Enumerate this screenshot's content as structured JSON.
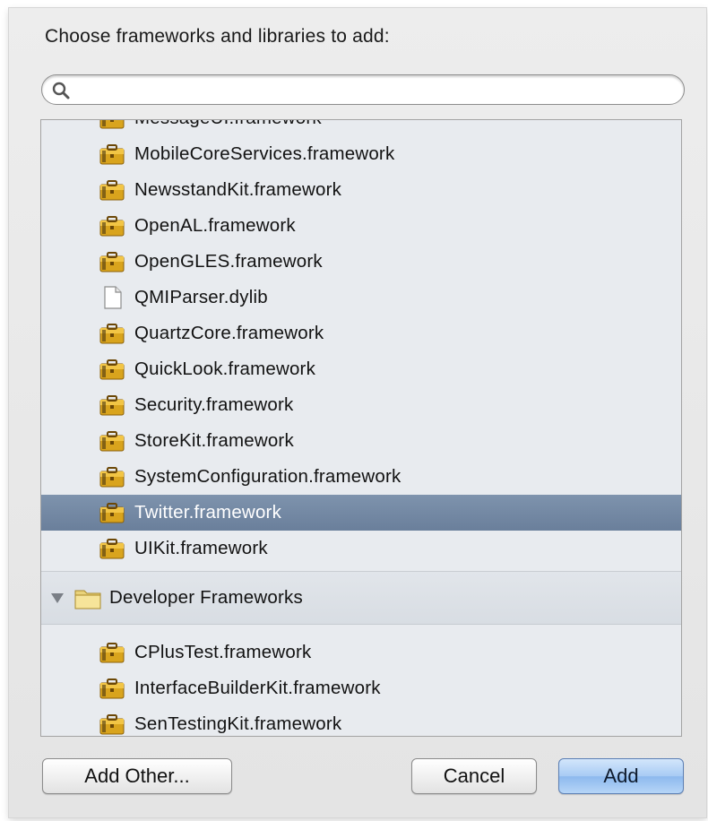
{
  "dialog": {
    "prompt": "Choose frameworks and libraries to add:",
    "search": {
      "value": "",
      "placeholder": ""
    }
  },
  "list": {
    "items": [
      {
        "label": "MessageUI.framework",
        "icon": "framework-toolbox-icon",
        "selected": false
      },
      {
        "label": "MobileCoreServices.framework",
        "icon": "framework-toolbox-icon",
        "selected": false
      },
      {
        "label": "NewsstandKit.framework",
        "icon": "framework-toolbox-icon",
        "selected": false
      },
      {
        "label": "OpenAL.framework",
        "icon": "framework-toolbox-icon",
        "selected": false
      },
      {
        "label": "OpenGLES.framework",
        "icon": "framework-toolbox-icon",
        "selected": false
      },
      {
        "label": "QMIParser.dylib",
        "icon": "document-icon",
        "selected": false
      },
      {
        "label": "QuartzCore.framework",
        "icon": "framework-toolbox-icon",
        "selected": false
      },
      {
        "label": "QuickLook.framework",
        "icon": "framework-toolbox-icon",
        "selected": false
      },
      {
        "label": "Security.framework",
        "icon": "framework-toolbox-icon",
        "selected": false
      },
      {
        "label": "StoreKit.framework",
        "icon": "framework-toolbox-icon",
        "selected": false
      },
      {
        "label": "SystemConfiguration.framework",
        "icon": "framework-toolbox-icon",
        "selected": false
      },
      {
        "label": "Twitter.framework",
        "icon": "framework-toolbox-icon",
        "selected": true
      },
      {
        "label": "UIKit.framework",
        "icon": "framework-toolbox-icon",
        "selected": false
      }
    ],
    "group": {
      "label": "Developer Frameworks",
      "expanded": true,
      "items": [
        {
          "label": "CPlusTest.framework",
          "icon": "framework-toolbox-icon"
        },
        {
          "label": "InterfaceBuilderKit.framework",
          "icon": "framework-toolbox-icon"
        },
        {
          "label": "SenTestingKit.framework",
          "icon": "framework-toolbox-icon"
        }
      ]
    }
  },
  "buttons": {
    "add_other": "Add Other...",
    "cancel": "Cancel",
    "add": "Add"
  },
  "colors": {
    "selection": "#7388a4",
    "list_background": "#e8ebef",
    "primary_button": "#a8cbf4"
  }
}
